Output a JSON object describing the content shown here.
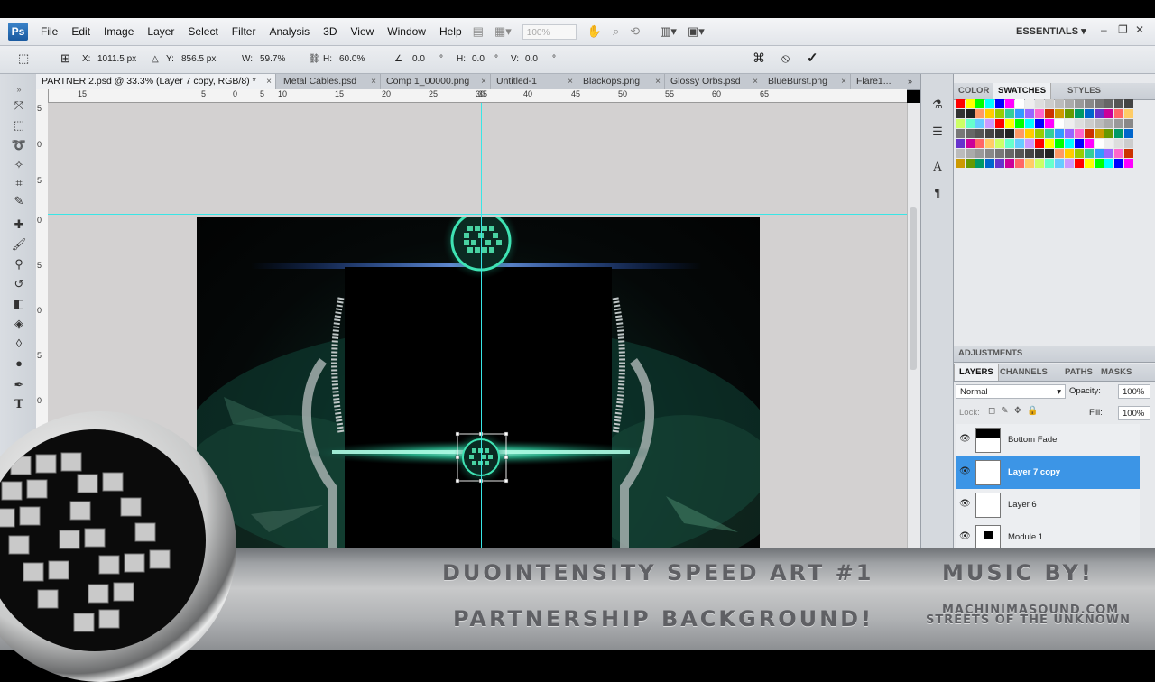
{
  "menu": {
    "logo": "Ps",
    "items": [
      "File",
      "Edit",
      "Image",
      "Layer",
      "Select",
      "Filter",
      "Analysis",
      "3D",
      "View",
      "Window",
      "Help"
    ],
    "zoom": "100%",
    "workspace": "ESSENTIALS ▾"
  },
  "options": {
    "x_label": "X:",
    "x_value": "1011.5 px",
    "y_label": "Y:",
    "y_value": "856.5 px",
    "w_label": "W:",
    "w_value": "59.7%",
    "h_label": "H:",
    "h_value": "60.0%",
    "angle_value": "0.0",
    "h2_label": "H:",
    "h2_value": "0.0",
    "v_label": "V:",
    "v_value": "0.0",
    "degree": "°"
  },
  "tabs": [
    {
      "label": "PARTNER 2.psd @ 33.3% (Layer 7 copy, RGB/8) *"
    },
    {
      "label": "Metal Cables.psd"
    },
    {
      "label": "Comp 1_00000.png"
    },
    {
      "label": "Untitled-1"
    },
    {
      "label": "Blackops.png"
    },
    {
      "label": "Glossy Orbs.psd"
    },
    {
      "label": "BlueBurst.png"
    },
    {
      "label": "Flare1..."
    }
  ],
  "tab_close": "×",
  "ruler_top": [
    "15",
    "5",
    "0",
    "5",
    "10",
    "15",
    "20",
    "25",
    "30",
    "35",
    "40",
    "45",
    "50",
    "55",
    "60",
    "65"
  ],
  "ruler_left": [
    "5",
    "0",
    "5",
    "0",
    "5",
    "0",
    "5",
    "0",
    "5"
  ],
  "panels": {
    "color_tabs": [
      "COLOR",
      "SWATCHES",
      "STYLES"
    ],
    "adjustments": "ADJUSTMENTS",
    "layer_tabs": [
      "LAYERS",
      "CHANNELS",
      "PATHS",
      "MASKS"
    ],
    "blend_mode": "Normal",
    "opacity_label": "Opacity:",
    "opacity_value": "100%",
    "lock_label": "Lock:",
    "fill_label": "Fill:",
    "fill_value": "100%",
    "layers": [
      {
        "name": "Bottom Fade",
        "selected": false
      },
      {
        "name": "Layer 7 copy",
        "selected": true
      },
      {
        "name": "Layer 6",
        "selected": false
      },
      {
        "name": "Module 1",
        "selected": false
      }
    ]
  },
  "overlay": {
    "title": "DUOINTENSITY SPEED ART #1",
    "subtitle": "PARTNERSHIP BACKGROUND!",
    "music_label": "MUSIC BY!",
    "music_site": "MACHINIMASOUND.COM",
    "music_track": "STREETS OF THE UNKNOWN"
  },
  "swatch_colors": [
    "#ff0000",
    "#ffff00",
    "#00ff00",
    "#00ffff",
    "#0000ff",
    "#ff00ff",
    "#ffffff",
    "#eeeeee",
    "#dddddd",
    "#cccccc",
    "#bbbbbb",
    "#aaaaaa",
    "#999999",
    "#888888",
    "#777777",
    "#666666",
    "#555555",
    "#444444",
    "#333333",
    "#222222",
    "#ff9966",
    "#ffcc00",
    "#99cc00",
    "#33cc99",
    "#3399ff",
    "#9966ff",
    "#ff66cc",
    "#cc3300",
    "#cc9900",
    "#669900",
    "#009966",
    "#0066cc",
    "#6633cc",
    "#cc0099",
    "#ff6666",
    "#ffcc66",
    "#ccff66",
    "#66ffcc",
    "#66ccff",
    "#cc99ff"
  ]
}
